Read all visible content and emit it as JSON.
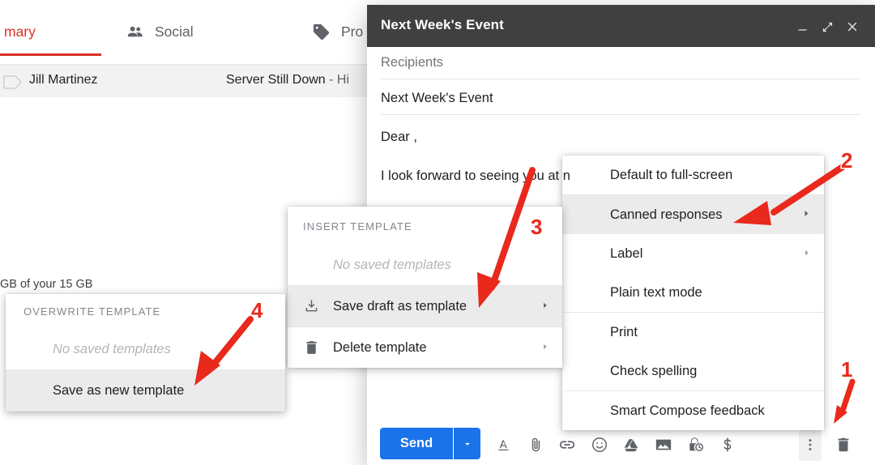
{
  "background": {
    "tabs": [
      {
        "label": "mary",
        "icon": "inbox-icon",
        "active": true
      },
      {
        "label": "Social",
        "icon": "people-icon",
        "active": false
      },
      {
        "label": "Pro",
        "icon": "tag-icon",
        "active": false
      }
    ],
    "email_row": {
      "icon": "chevron-label-icon",
      "sender": "Jill Martinez",
      "subject": "Server Still Down",
      "snippet": " - Hi"
    },
    "storage_text": "GB of your 15 GB"
  },
  "compose": {
    "title": "Next Week's Event",
    "window_buttons": {
      "minimize": "minimize-icon",
      "maximize": "fullscreen-icon",
      "close": "close-icon"
    },
    "recipients_placeholder": "Recipients",
    "subject_value": "Next Week's Event",
    "body_lines": [
      "Dear ,",
      "I look forward to seeing you at n"
    ],
    "toolbar": {
      "send_label": "Send",
      "send_caret": "caret-down-icon",
      "icons": [
        {
          "name": "formatting-options-icon"
        },
        {
          "name": "attach-file-icon"
        },
        {
          "name": "insert-link-icon"
        },
        {
          "name": "insert-emoji-icon"
        },
        {
          "name": "insert-drive-icon"
        },
        {
          "name": "insert-photo-icon"
        },
        {
          "name": "confidential-mode-icon"
        },
        {
          "name": "insert-money-icon"
        }
      ],
      "more_options_icon": "more-options-vertical-icon",
      "discard_icon": "trash-icon"
    }
  },
  "menus": {
    "main": {
      "items": [
        {
          "label": "Default to full-screen",
          "submenu": false,
          "highlighted": false
        },
        {
          "label": "Canned responses",
          "submenu": true,
          "highlighted": true
        },
        {
          "label": "Label",
          "submenu": true,
          "highlighted": false
        },
        {
          "label": "Plain text mode",
          "submenu": false,
          "highlighted": false
        },
        {
          "label": "Print",
          "submenu": false,
          "highlighted": false
        },
        {
          "label": "Check spelling",
          "submenu": false,
          "highlighted": false
        },
        {
          "label": "Smart Compose feedback",
          "submenu": false,
          "highlighted": false
        }
      ]
    },
    "middle": {
      "section_label": "INSERT TEMPLATE",
      "empty_label": "No saved templates",
      "items": [
        {
          "label": "Save draft as template",
          "icon": "save-download-icon",
          "submenu": true,
          "highlighted": true
        },
        {
          "label": "Delete template",
          "icon": "trash-icon",
          "submenu": true,
          "highlighted": false
        }
      ]
    },
    "left": {
      "section_label": "OVERWRITE TEMPLATE",
      "empty_label": "No saved templates",
      "items": [
        {
          "label": "Save as new template",
          "submenu": false,
          "highlighted": true
        }
      ]
    }
  },
  "annotations": {
    "color": "#E8291C",
    "markers": [
      {
        "number": "1",
        "target": "more-options-vertical-icon"
      },
      {
        "number": "2",
        "target": "canned-responses-menu-item"
      },
      {
        "number": "3",
        "target": "save-draft-as-template-menu-item"
      },
      {
        "number": "4",
        "target": "save-as-new-template-menu-item"
      }
    ]
  }
}
